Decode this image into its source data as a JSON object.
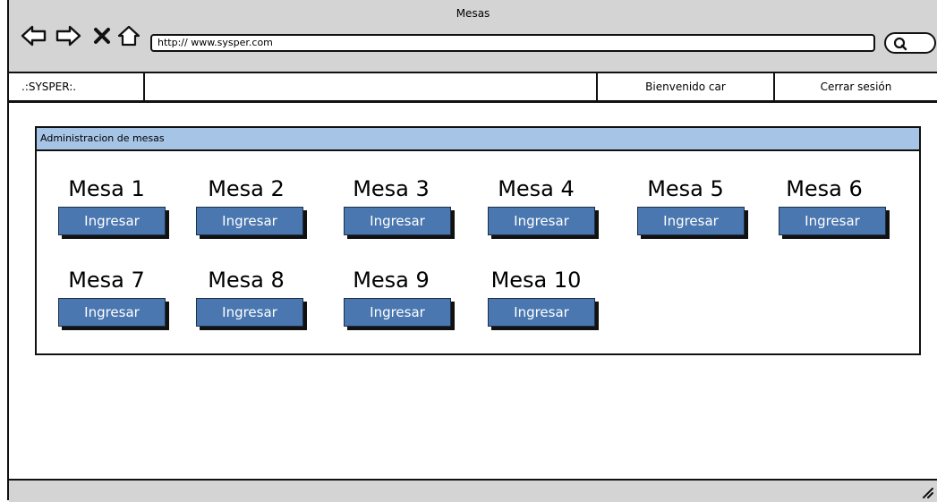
{
  "window": {
    "title": "Mesas"
  },
  "browser": {
    "url": "http:// www.sysper.com"
  },
  "menubar": {
    "brand": ".:SYSPER:.",
    "welcome": "Bienvenido car",
    "logout": "Cerrar sesión"
  },
  "panel": {
    "title": "Administracion de mesas"
  },
  "mesas": [
    {
      "label": "Mesa 1",
      "button": "Ingresar"
    },
    {
      "label": "Mesa 2",
      "button": "Ingresar"
    },
    {
      "label": "Mesa 3",
      "button": "Ingresar"
    },
    {
      "label": "Mesa 4",
      "button": "Ingresar"
    },
    {
      "label": "Mesa 5",
      "button": "Ingresar"
    },
    {
      "label": "Mesa 6",
      "button": "Ingresar"
    },
    {
      "label": "Mesa 7",
      "button": "Ingresar"
    },
    {
      "label": "Mesa 8",
      "button": "Ingresar"
    },
    {
      "label": "Mesa 9",
      "button": "Ingresar"
    },
    {
      "label": "Mesa 10",
      "button": "Ingresar"
    }
  ],
  "colors": {
    "accent_button": "#4a77b0",
    "panel_header": "#a6c4e6",
    "chrome": "#d4d4d4"
  },
  "icons": [
    "back-arrow-icon",
    "forward-arrow-icon",
    "close-icon",
    "home-icon",
    "search-icon",
    "resize-grip-icon"
  ]
}
